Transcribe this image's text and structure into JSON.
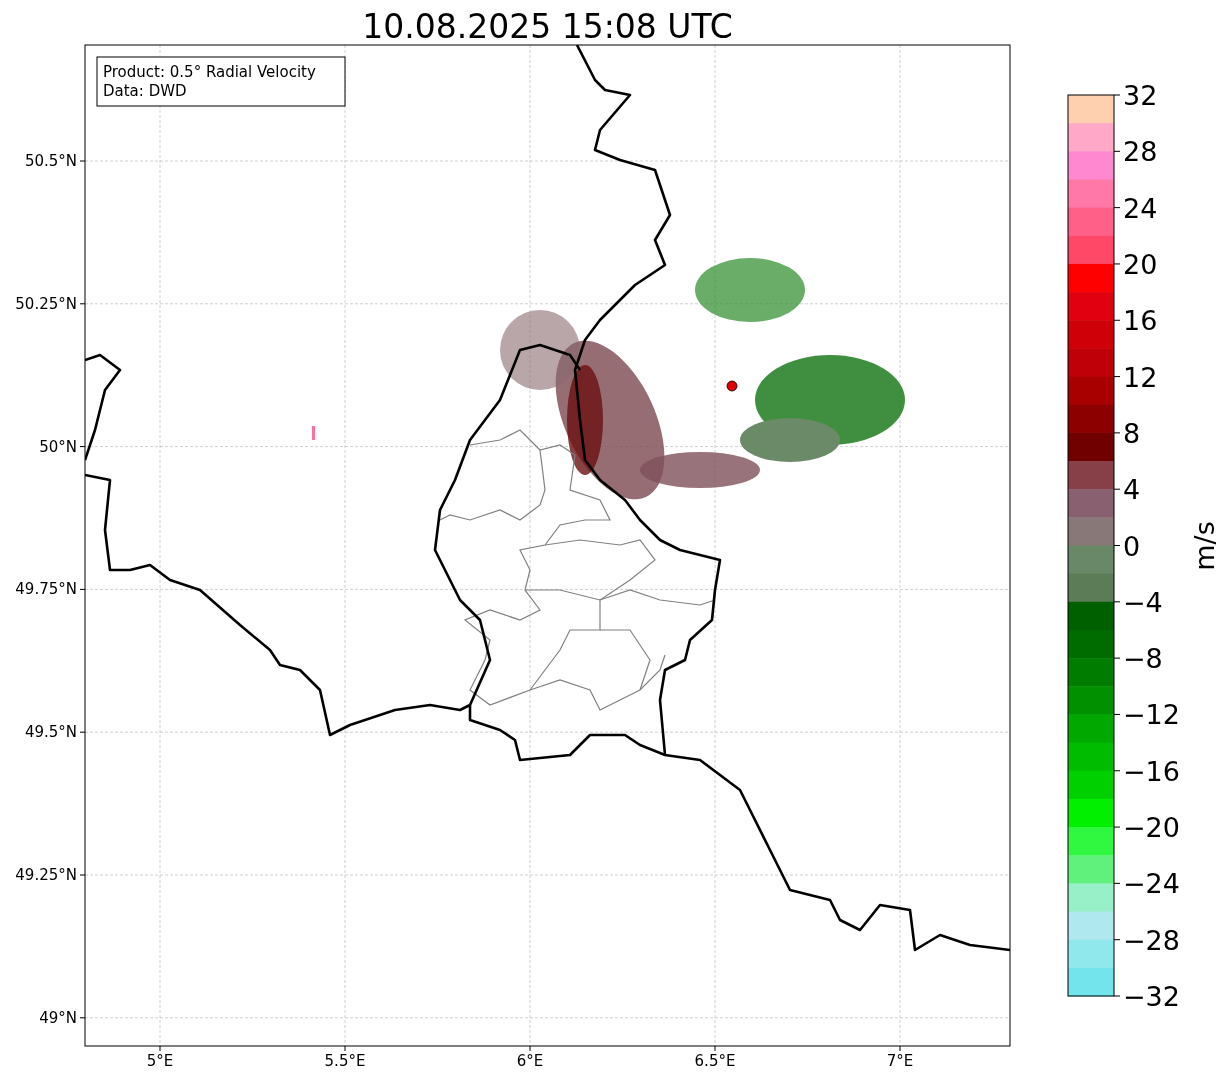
{
  "title": "10.08.2025 15:08 UTC",
  "info_box": [
    "Product: 0.5° Radial Velocity",
    "Data: DWD"
  ],
  "map": {
    "xticks": [
      "5°E",
      "5.5°E",
      "6°E",
      "6.5°E",
      "7°E"
    ],
    "yticks": [
      "50.5°N",
      "50.25°N",
      "50°N",
      "49.75°N",
      "49.5°N",
      "49.25°N",
      "49°N"
    ]
  },
  "colorbar": {
    "label": "m/s",
    "segments": [
      {
        "color": "#ffd0b0"
      },
      {
        "color": "#ffa8c8"
      },
      {
        "color": "#ff88d0"
      },
      {
        "color": "#ff78a8"
      },
      {
        "color": "#ff6088"
      },
      {
        "color": "#ff4868"
      },
      {
        "color": "#ff0000"
      },
      {
        "color": "#e00010"
      },
      {
        "color": "#d00008"
      },
      {
        "color": "#c00008"
      },
      {
        "color": "#a80000"
      },
      {
        "color": "#8c0000"
      },
      {
        "color": "#700000"
      },
      {
        "color": "#884048"
      },
      {
        "color": "#886070"
      },
      {
        "color": "#887878"
      },
      {
        "color": "#688868"
      },
      {
        "color": "#5c7c58"
      },
      {
        "color": "#006000"
      },
      {
        "color": "#006c00"
      },
      {
        "color": "#007c00"
      },
      {
        "color": "#009000"
      },
      {
        "color": "#00a800"
      },
      {
        "color": "#00bc00"
      },
      {
        "color": "#00d000"
      },
      {
        "color": "#00f000"
      },
      {
        "color": "#30f840"
      },
      {
        "color": "#60f07c"
      },
      {
        "color": "#98f0c8"
      },
      {
        "color": "#b0e8f0"
      },
      {
        "color": "#90e8ec"
      },
      {
        "color": "#74e4ec"
      }
    ],
    "ticks": [
      "32",
      "28",
      "24",
      "20",
      "16",
      "12",
      "8",
      "4",
      "0",
      "−4",
      "−8",
      "−12",
      "−16",
      "−20",
      "−24",
      "−28",
      "−32"
    ]
  }
}
